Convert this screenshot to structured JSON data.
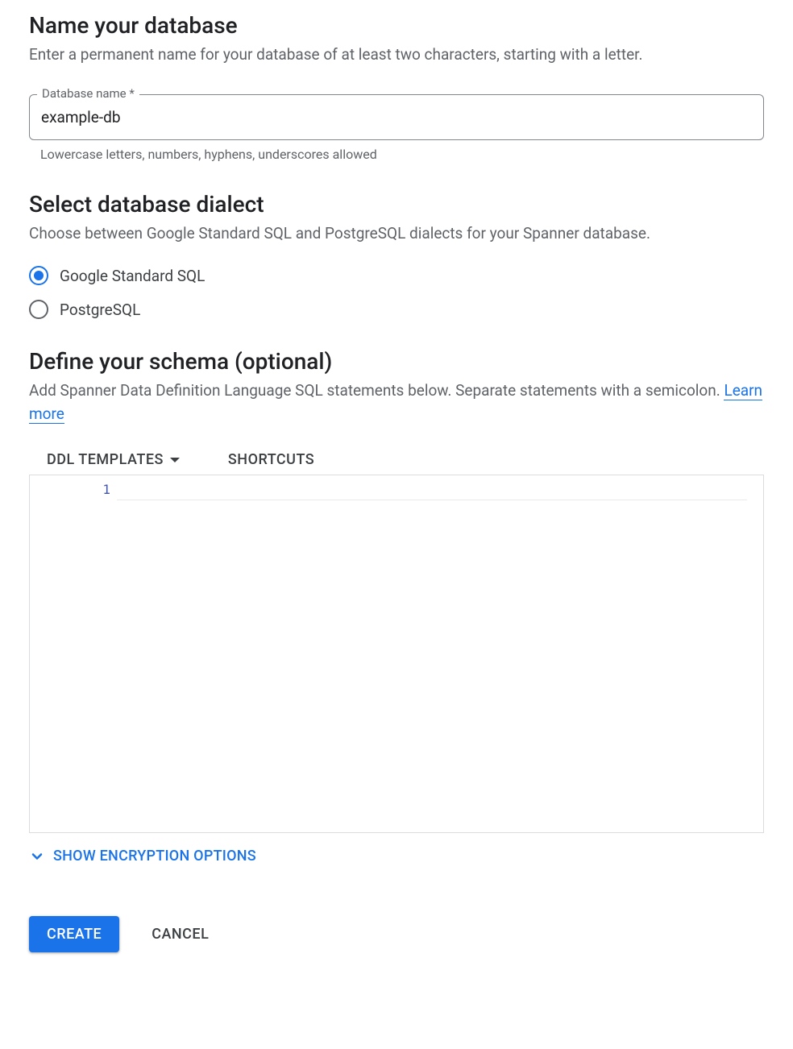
{
  "name_section": {
    "title": "Name your database",
    "description": "Enter a permanent name for your database of at least two characters, starting with a letter.",
    "field_label": "Database name *",
    "field_value": "example-db",
    "helper": "Lowercase letters, numbers, hyphens, underscores allowed"
  },
  "dialect_section": {
    "title": "Select database dialect",
    "description": "Choose between Google Standard SQL and PostgreSQL dialects for your Spanner database.",
    "options": [
      {
        "label": "Google Standard SQL",
        "selected": true
      },
      {
        "label": "PostgreSQL",
        "selected": false
      }
    ]
  },
  "schema_section": {
    "title": "Define your schema (optional)",
    "description_prefix": "Add Spanner Data Definition Language SQL statements below. Separate statements with a semicolon. ",
    "learn_more": "Learn more",
    "toolbar": {
      "ddl_templates": "DDL TEMPLATES",
      "shortcuts": "SHORTCUTS"
    },
    "editor": {
      "line_number": "1",
      "line_content": ""
    }
  },
  "encryption": {
    "label": "SHOW ENCRYPTION OPTIONS"
  },
  "buttons": {
    "create": "CREATE",
    "cancel": "CANCEL"
  }
}
